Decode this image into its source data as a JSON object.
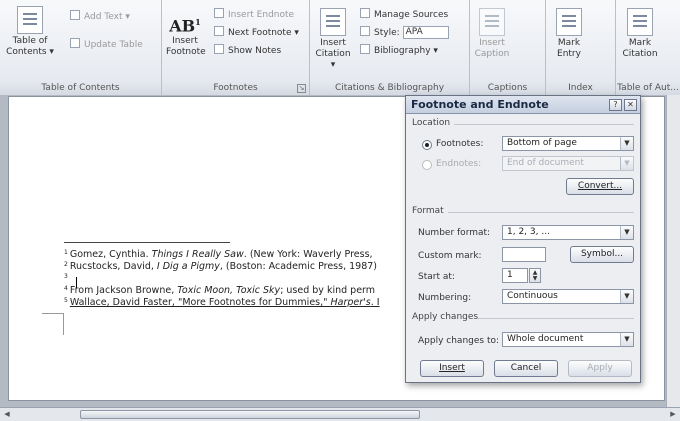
{
  "ribbon": {
    "toc": {
      "table_of_contents_line1": "Table of",
      "table_of_contents_line2": "Contents ▾",
      "add_text": "Add Text ▾",
      "update_table": "Update Table",
      "group_label": "Table of Contents"
    },
    "footnotes": {
      "insert_footnote_line1": "Insert",
      "insert_footnote_line2": "Footnote",
      "ab_glyph": "AB",
      "ab_sup": "1",
      "insert_endnote": "Insert Endnote",
      "next_footnote": "Next Footnote ▾",
      "show_notes": "Show Notes",
      "group_label": "Footnotes"
    },
    "citations": {
      "insert_citation_line1": "Insert",
      "insert_citation_line2": "Citation ▾",
      "manage_sources": "Manage Sources",
      "style_label": "Style:",
      "style_value": "APA",
      "bibliography": "Bibliography ▾",
      "group_label": "Citations & Bibliography"
    },
    "captions": {
      "insert_caption_line1": "Insert",
      "insert_caption_line2": "Caption",
      "group_label": "Captions"
    },
    "index": {
      "mark_entry_line1": "Mark",
      "mark_entry_line2": "Entry",
      "group_label": "Index"
    },
    "toa": {
      "mark_citation_line1": "Mark",
      "mark_citation_line2": "Citation",
      "group_label": "Table of Aut..."
    }
  },
  "document": {
    "footnotes": [
      {
        "num": "1",
        "parts": [
          {
            "t": "Gomez, Cynthia. "
          },
          {
            "t": "Things I Really Saw",
            "i": true
          },
          {
            "t": ". (New York: Waverly Press, "
          }
        ]
      },
      {
        "num": "2",
        "parts": [
          {
            "t": "Rucstocks, David, "
          },
          {
            "t": "I Dig a Pigmy",
            "i": true
          },
          {
            "t": ", (Boston: Academic Press, 1987)"
          }
        ]
      },
      {
        "num": "3",
        "parts": [
          {
            "t": ""
          }
        ]
      },
      {
        "num": "4",
        "parts": [
          {
            "t": "From Jackson Browne, "
          },
          {
            "t": "Toxic Moon, Toxic Sky",
            "i": true
          },
          {
            "t": "; used by kind perm"
          }
        ]
      },
      {
        "num": "5",
        "parts": [
          {
            "t": "Wallace, David Faster, \"More Footnotes for Dummies,\" ",
            "u": true
          },
          {
            "t": "Harper's",
            "i": true,
            "u": true
          },
          {
            "t": ". I",
            "u": true
          }
        ]
      }
    ]
  },
  "dialog": {
    "title": "Footnote and Endnote",
    "help_button": "?",
    "close_button": "✕",
    "location": {
      "section_label": "Location",
      "footnotes_label": "Footnotes:",
      "footnotes_value": "Bottom of page",
      "endnotes_label": "Endnotes:",
      "endnotes_value": "End of document",
      "convert_button": "Convert..."
    },
    "format": {
      "section_label": "Format",
      "number_format_label": "Number format:",
      "number_format_value": "1, 2, 3, ...",
      "custom_mark_label": "Custom mark:",
      "custom_mark_value": "",
      "symbol_button": "Symbol...",
      "start_at_label": "Start at:",
      "start_at_value": "1",
      "numbering_label": "Numbering:",
      "numbering_value": "Continuous"
    },
    "apply": {
      "section_label": "Apply changes",
      "apply_to_label": "Apply changes to:",
      "apply_to_value": "Whole document"
    },
    "insert_button": "Insert",
    "cancel_button": "Cancel",
    "apply_button": "Apply"
  },
  "colors": {
    "ribbon_bg": "#e3e7ee",
    "dialog_bg": "#eceef2",
    "dialog_title": "#1a2a44",
    "page_bg": "#ffffff"
  }
}
